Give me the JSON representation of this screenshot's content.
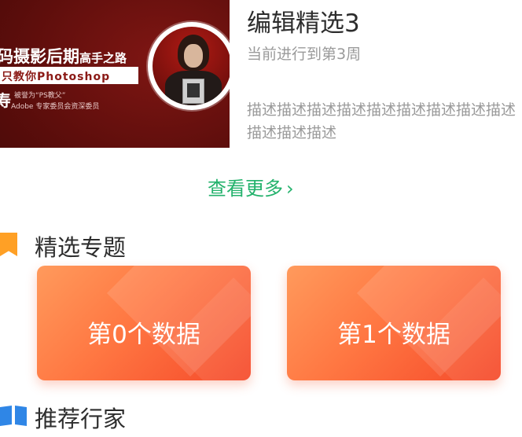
{
  "banner": {
    "line1_main": "码摄影后期",
    "line1_small": "高手之路",
    "line2": "只教你Photoshop",
    "line3": "寿",
    "line4": "被誉为“PS教父”",
    "line5": "Adobe 专家委员会资深委员"
  },
  "article": {
    "title": "编辑精选3",
    "subtitle": "当前进行到第3周",
    "description": "描述描述描述描述描述描述描述描述描述描述描述描述"
  },
  "more": {
    "label": "查看更多",
    "chevron": "›"
  },
  "featured": {
    "title": "精选专题",
    "icon": "bookmark-icon",
    "icon_color": "#ffa025",
    "cards": [
      {
        "label": "第0个数据"
      },
      {
        "label": "第1个数据"
      }
    ]
  },
  "recommend": {
    "title": "推荐行家",
    "icon": "book-icon",
    "icon_color": "#2f86e6"
  },
  "colors": {
    "accent_green": "#23b26c",
    "card_gradient_start": "#ff9a5c",
    "card_gradient_end": "#f5492a"
  }
}
